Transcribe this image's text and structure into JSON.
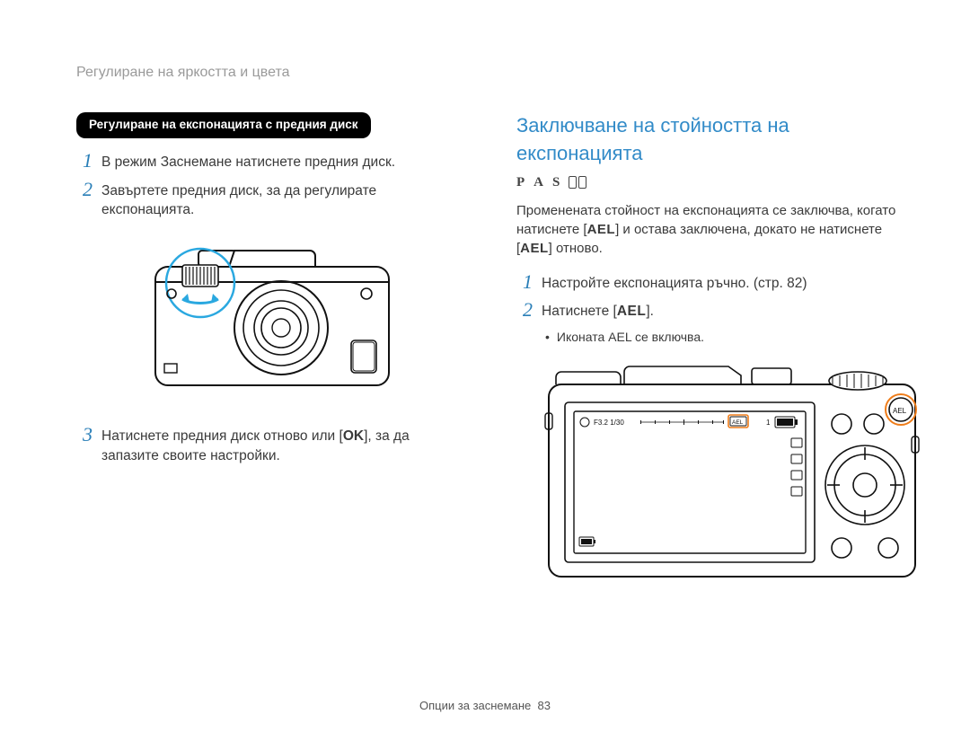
{
  "breadcrumb": "Регулиране на яркостта и цвета",
  "left": {
    "pill": "Регулиране на експонацията с предния диск",
    "step1": "В режим Заснемане натиснете предния диск.",
    "step2": "Завъртете предния диск, за да регулирате експонацията.",
    "step3_a": "Натиснете предния диск отново или [",
    "step3_key": "OK",
    "step3_b": "], за да запазите своите настройки."
  },
  "right": {
    "heading": "Заключване на стойността на експонацията",
    "modes": {
      "p": "P",
      "a": "A",
      "s": "S"
    },
    "intro_a": "Променената стойност на експонацията се заключва, когато натиснете [",
    "intro_key1": "AEL",
    "intro_b": "] и остава заключена, докато не натиснете [",
    "intro_key2": "AEL",
    "intro_c": "] отново.",
    "step1": "Настройте експонацията ръчно. (стр. 82)",
    "step2_a": "Натиснете [",
    "step2_key": "AEL",
    "step2_b": "].",
    "bullet1": "Иконата AEL се включва."
  },
  "footer_label": "Опции за заснемане",
  "footer_page": "83",
  "nums": {
    "n1": "1",
    "n2": "2",
    "n3": "3"
  },
  "camera_back_osd": {
    "aperture_shutter": "F3.2 1/30",
    "ael": "AEL",
    "count": "1"
  }
}
